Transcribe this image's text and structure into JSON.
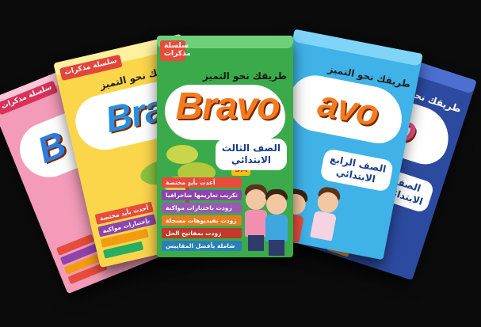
{
  "scene": "fan of Bravo workbook covers",
  "books": [
    {
      "id": "pink",
      "logo": "B",
      "series_badge": "سلسلة مذكرات",
      "colors": {
        "cover": "#f39bb8",
        "logo": "#2f7be0",
        "badge": "#d8325b"
      }
    },
    {
      "id": "yellow",
      "logo": "Bra",
      "series_badge": "سلسلة مذكرات",
      "tagline": "طريقك نحو التميز",
      "features": [
        "أحدث بأيد مختصة",
        "بإختبارات مواكبة"
      ],
      "colors": {
        "cover": "#fbd64a",
        "logo": "#2a8ee0",
        "badge": "#e3453b"
      }
    },
    {
      "id": "green",
      "logo": "Bravo",
      "series_badge": "سلسلة مذكرات",
      "tagline": "طريقك نحو التميز",
      "grade_line1": "الصف الثالث",
      "grade_line2": "الابتدائي",
      "term": "3A",
      "features": [
        "أعدت بأيدٍ مختصة",
        "تكريب تعاريمها ضاخرافيا",
        "زودت باختبارات مواكبة",
        "زودت بفيديوهات مسجلة",
        "زودت بمفاتيح الحل",
        "شاملة بأفضل المقاييس"
      ],
      "colors": {
        "cover": "#3aaa4a",
        "logo": "#f47a1f",
        "badge": "#e74c3c"
      }
    },
    {
      "id": "sky",
      "logo": "avo",
      "tagline": "طريقك نحو التميز",
      "grade_line1": "الصف الرابع",
      "grade_line2": "الابتدائي",
      "colors": {
        "cover": "#3fb2e8",
        "logo": "#f47a1f"
      }
    },
    {
      "id": "navy",
      "logo": "vo",
      "tagline": "طريقك نحو التميز",
      "grade_line1": "الصف",
      "grade_line2": "الابتدائي",
      "colors": {
        "cover": "#2c4aa0",
        "logo": "#ec4f8a"
      }
    }
  ]
}
